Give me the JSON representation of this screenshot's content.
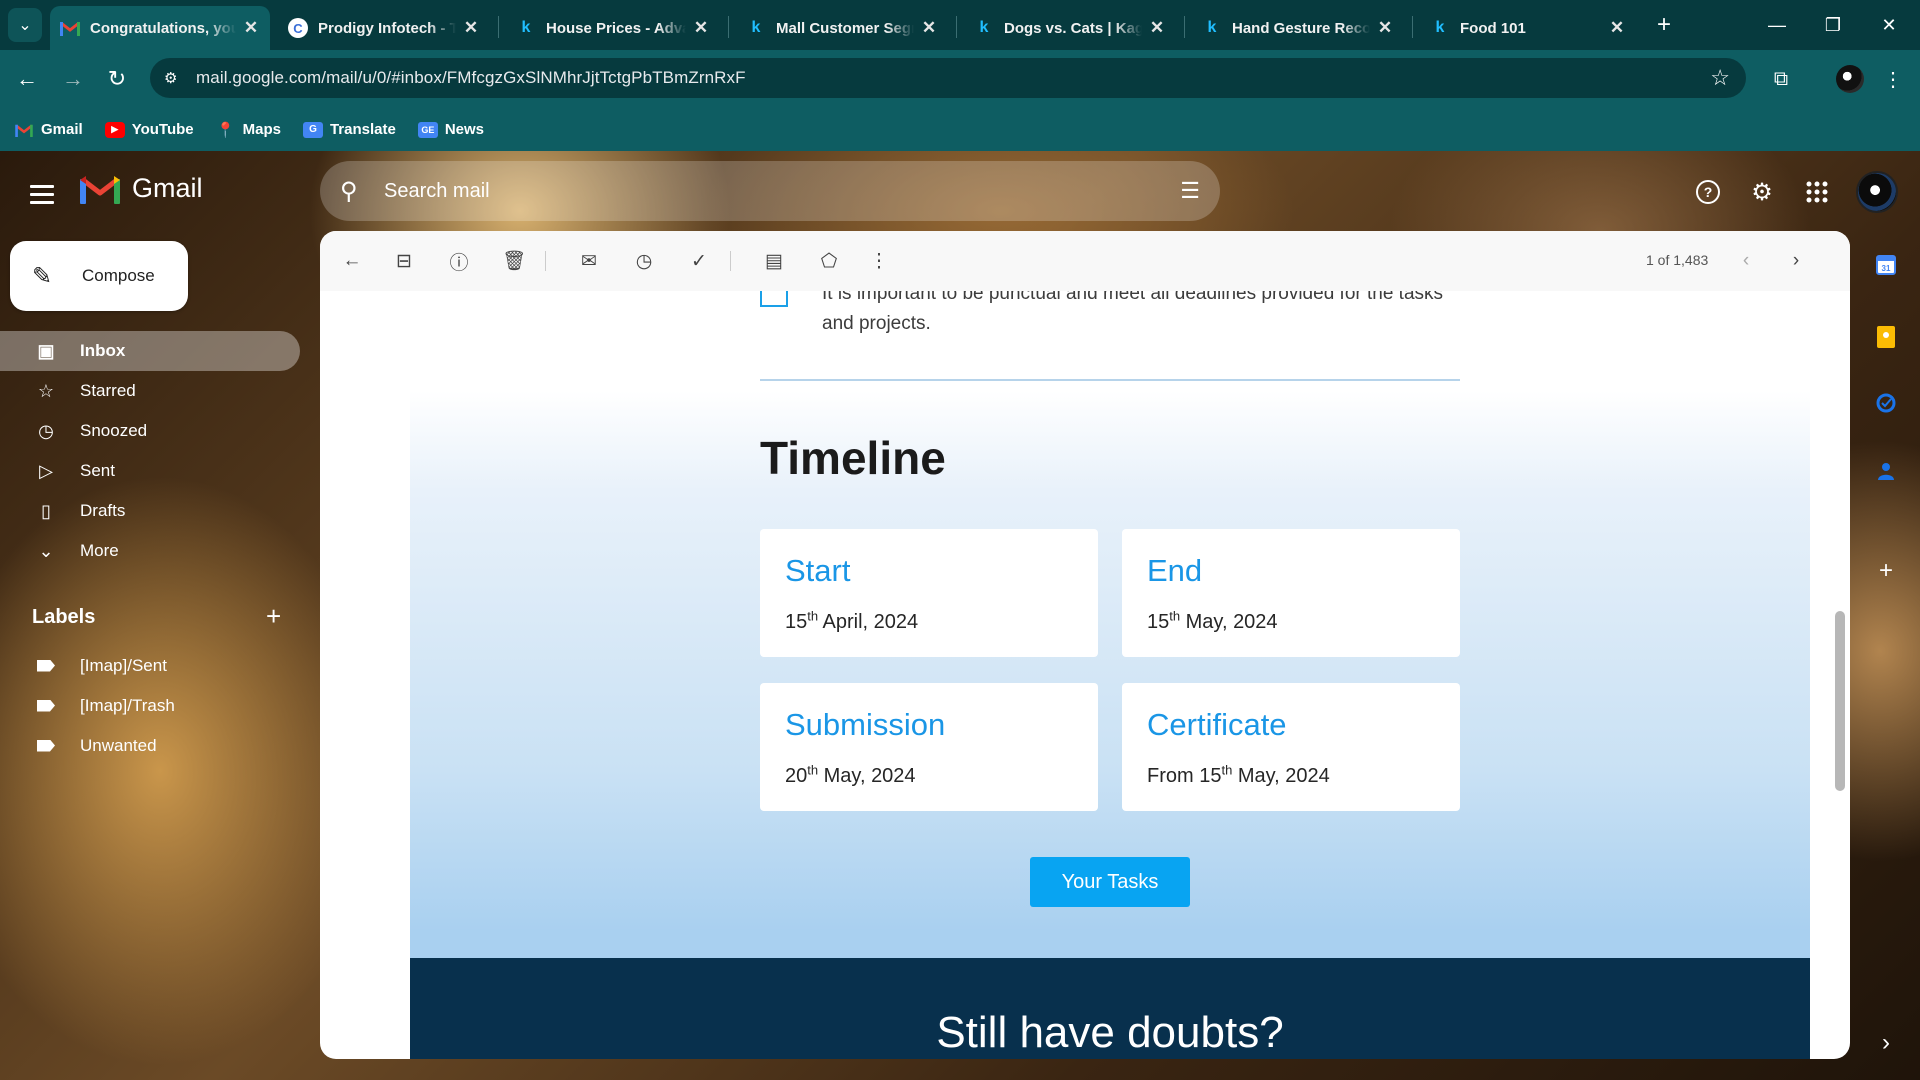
{
  "browser": {
    "tabs": [
      {
        "title": "Congratulations, you",
        "favicon": "gmail-icon",
        "active": true
      },
      {
        "title": "Prodigy Infotech - Ta",
        "favicon": "prodigy-icon",
        "active": false
      },
      {
        "title": "House Prices - Advar",
        "favicon": "kaggle-icon",
        "active": false
      },
      {
        "title": "Mall Customer Segm",
        "favicon": "kaggle-icon",
        "active": false
      },
      {
        "title": "Dogs vs. Cats | Kagg",
        "favicon": "kaggle-icon",
        "active": false
      },
      {
        "title": "Hand Gesture Recog",
        "favicon": "kaggle-icon",
        "active": false
      },
      {
        "title": "Food 101",
        "favicon": "kaggle-icon",
        "active": false
      }
    ],
    "url": "mail.google.com/mail/u/0/#inbox/FMfcgzGxSlNMhrJjtTctgPbTBmZrnRxF",
    "bookmarks": [
      {
        "label": "Gmail",
        "icon": "gmail-icon"
      },
      {
        "label": "YouTube",
        "icon": "youtube-icon"
      },
      {
        "label": "Maps",
        "icon": "maps-icon"
      },
      {
        "label": "Translate",
        "icon": "translate-icon"
      },
      {
        "label": "News",
        "icon": "news-icon"
      }
    ],
    "colors": {
      "chrome_dark": "#063a3e",
      "chrome": "#0e5d62"
    }
  },
  "gmail": {
    "logo_text": "Gmail",
    "search_placeholder": "Search mail",
    "compose_label": "Compose",
    "nav": [
      {
        "label": "Inbox",
        "icon": "inbox-icon",
        "active": true
      },
      {
        "label": "Starred",
        "icon": "star-icon",
        "active": false
      },
      {
        "label": "Snoozed",
        "icon": "clock-icon",
        "active": false
      },
      {
        "label": "Sent",
        "icon": "send-icon",
        "active": false
      },
      {
        "label": "Drafts",
        "icon": "draft-icon",
        "active": false
      },
      {
        "label": "More",
        "icon": "chevron-down-icon",
        "active": false
      }
    ],
    "labels_heading": "Labels",
    "labels": [
      "[Imap]/Sent",
      "[Imap]/Trash",
      "Unwanted"
    ],
    "counter": "1 of 1,483"
  },
  "email": {
    "rule_text": "It is important to be punctual and meet all deadlines provided for the tasks and projects.",
    "timeline_title": "Timeline",
    "cards": [
      {
        "title": "Start",
        "day": "15",
        "suffix": "th",
        "rest": " April, 2024",
        "prefix": ""
      },
      {
        "title": "End",
        "day": "15",
        "suffix": "th",
        "rest": " May, 2024",
        "prefix": ""
      },
      {
        "title": "Submission",
        "day": "20",
        "suffix": "th",
        "rest": " May, 2024",
        "prefix": ""
      },
      {
        "title": "Certificate",
        "day": "15",
        "suffix": "th",
        "rest": " May, 2024",
        "prefix": "From "
      }
    ],
    "tasks_button": "Your Tasks",
    "doubts_title": "Still have doubts?",
    "colors": {
      "accent": "#1a96e6",
      "button": "#08a4f2",
      "footer": "#08304d"
    }
  }
}
